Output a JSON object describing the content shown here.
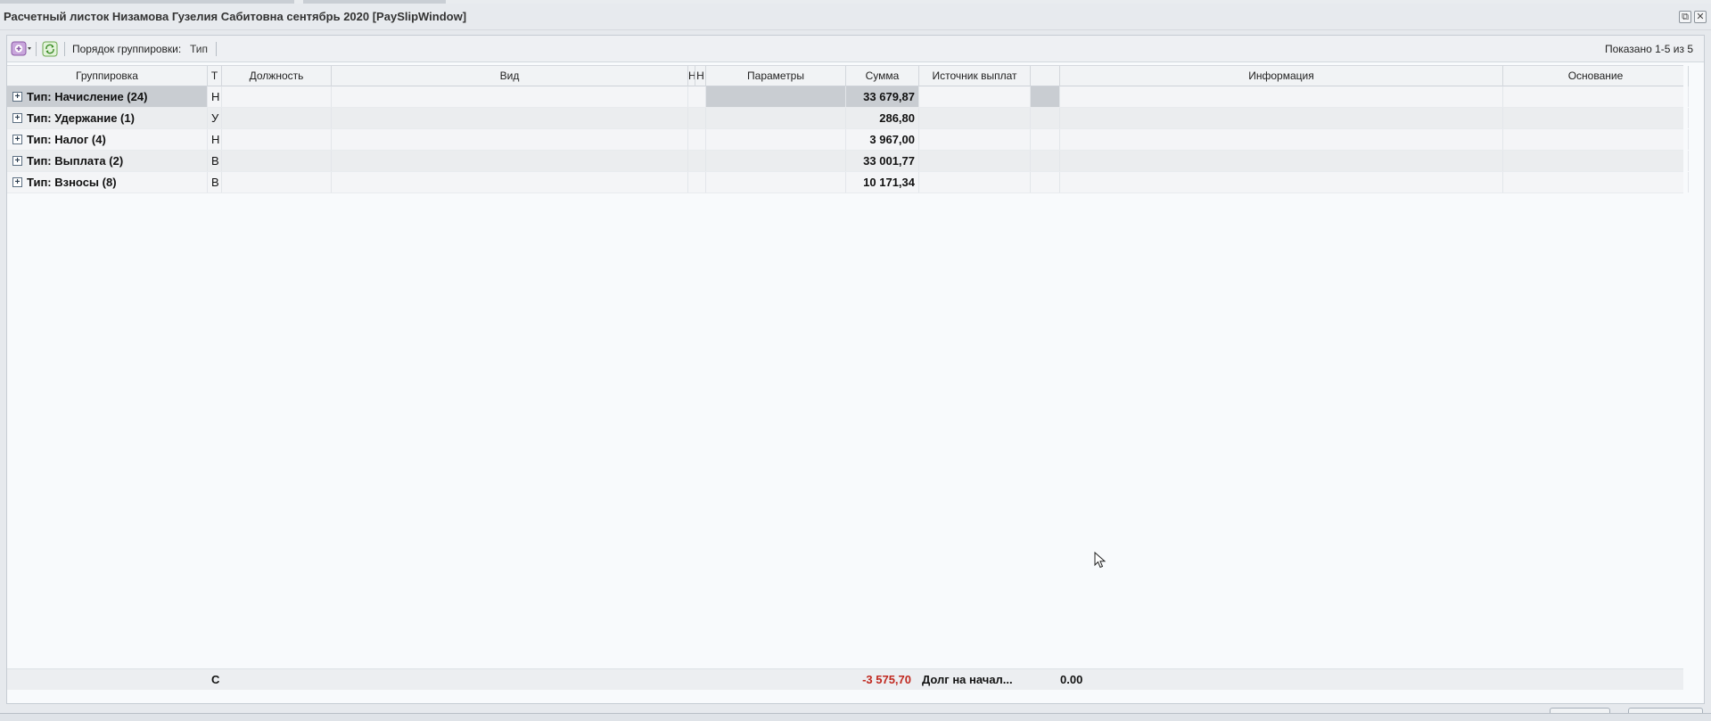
{
  "window": {
    "title": "Расчетный листок Низамова Гузелия Сабитовна сентябрь 2020 [PaySlipWindow]",
    "restore_symbol": "⧉",
    "close_symbol": "✕"
  },
  "toolbar": {
    "add_icon": "add-dropdown-icon",
    "refresh_icon": "refresh-icon",
    "grouping_label": "Порядок группировки:",
    "grouping_value": "Тип",
    "shown_text": "Показано 1-5 из 5"
  },
  "columns": {
    "group": "Группировка",
    "type": "Т",
    "position": "Должность",
    "kind": "Вид",
    "c5": "Н",
    "c6": "Н",
    "params": "Параметры",
    "sum": "Сумма",
    "source": "Источник выплат",
    "c10": "",
    "info": "Информация",
    "basis": "Основание"
  },
  "rows": [
    {
      "group": "Тип: Начисление (24)",
      "type": "Н",
      "sum": "33 679,87"
    },
    {
      "group": "Тип: Удержание (1)",
      "type": "У",
      "sum": "286,80"
    },
    {
      "group": "Тип: Налог (4)",
      "type": "Н",
      "sum": "3 967,00"
    },
    {
      "group": "Тип: Выплата (2)",
      "type": "В",
      "sum": "33 001,77"
    },
    {
      "group": "Тип: Взносы (8)",
      "type": "В",
      "sum": "10 171,34"
    }
  ],
  "footer": {
    "type": "С",
    "sum": "-3 575,70",
    "source": "Долг на начал...",
    "info": "0.00"
  },
  "colors": {
    "negative": "#c0281f",
    "selected_row": "#c9cdd2"
  }
}
